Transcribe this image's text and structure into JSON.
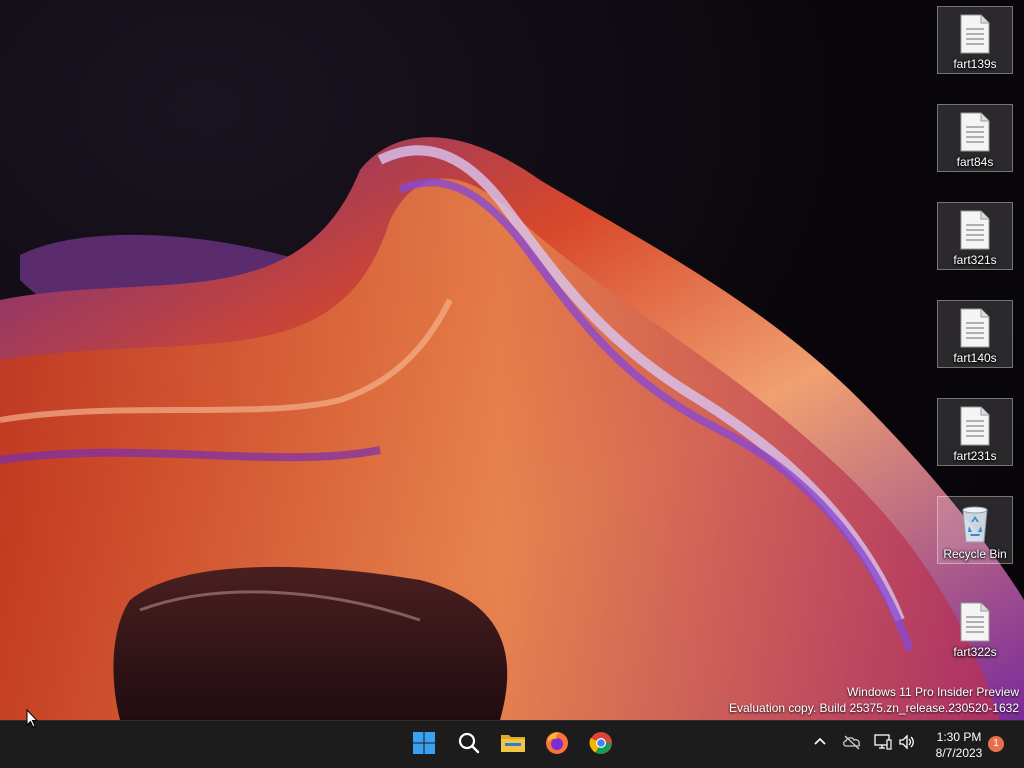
{
  "desktop": {
    "icons": [
      {
        "label": "fart139s",
        "type": "text-file"
      },
      {
        "label": "fart84s",
        "type": "text-file"
      },
      {
        "label": "fart321s",
        "type": "text-file"
      },
      {
        "label": "fart140s",
        "type": "text-file"
      },
      {
        "label": "fart231s",
        "type": "text-file"
      },
      {
        "label": "Recycle Bin",
        "type": "recycle-bin"
      },
      {
        "label": "fart322s",
        "type": "text-file"
      }
    ],
    "watermark": {
      "line1": "Windows 11 Pro Insider Preview",
      "line2": "Evaluation copy. Build 25375.zn_release.230520-1632"
    }
  },
  "taskbar": {
    "apps": [
      "start-icon",
      "search-icon",
      "file-explorer-icon",
      "firefox-icon",
      "chrome-icon"
    ],
    "tray": [
      "chevron-up-icon",
      "onedrive-icon",
      "network-icon",
      "volume-icon"
    ],
    "clock": {
      "time": "1:30 PM",
      "date": "8/7/2023"
    },
    "notifications": "1"
  },
  "colors": {
    "taskbar_bg": "#1c1c1c",
    "start_blue": "#3aa0f0",
    "folder_yellow": "#f4c542",
    "badge": "#e8704f"
  }
}
